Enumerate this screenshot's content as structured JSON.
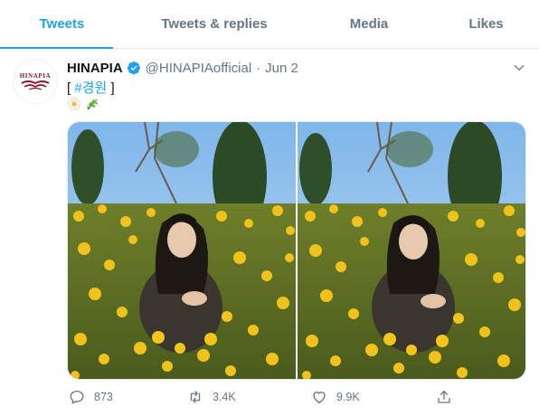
{
  "tabs": [
    {
      "label": "Tweets",
      "active": true
    },
    {
      "label": "Tweets & replies",
      "active": false
    },
    {
      "label": "Media",
      "active": false
    },
    {
      "label": "Likes",
      "active": false
    }
  ],
  "tweet": {
    "author_name": "HINAPIA",
    "handle": "@HINAPIAofficial",
    "separator": "·",
    "date": "Jun 2",
    "logo_text": "HINAPIA",
    "text_open": "[ ",
    "hashtag": "#경원",
    "text_close": " ]",
    "emoji": [
      "blossom-emoji",
      "herb-emoji"
    ],
    "media": [
      "photo-1",
      "photo-2"
    ],
    "stats": {
      "replies": "873",
      "retweets": "3.4K",
      "likes": "9.9K"
    }
  },
  "colors": {
    "accent": "#1da1f2",
    "muted": "#657786",
    "logo": "#8b1a2b"
  }
}
